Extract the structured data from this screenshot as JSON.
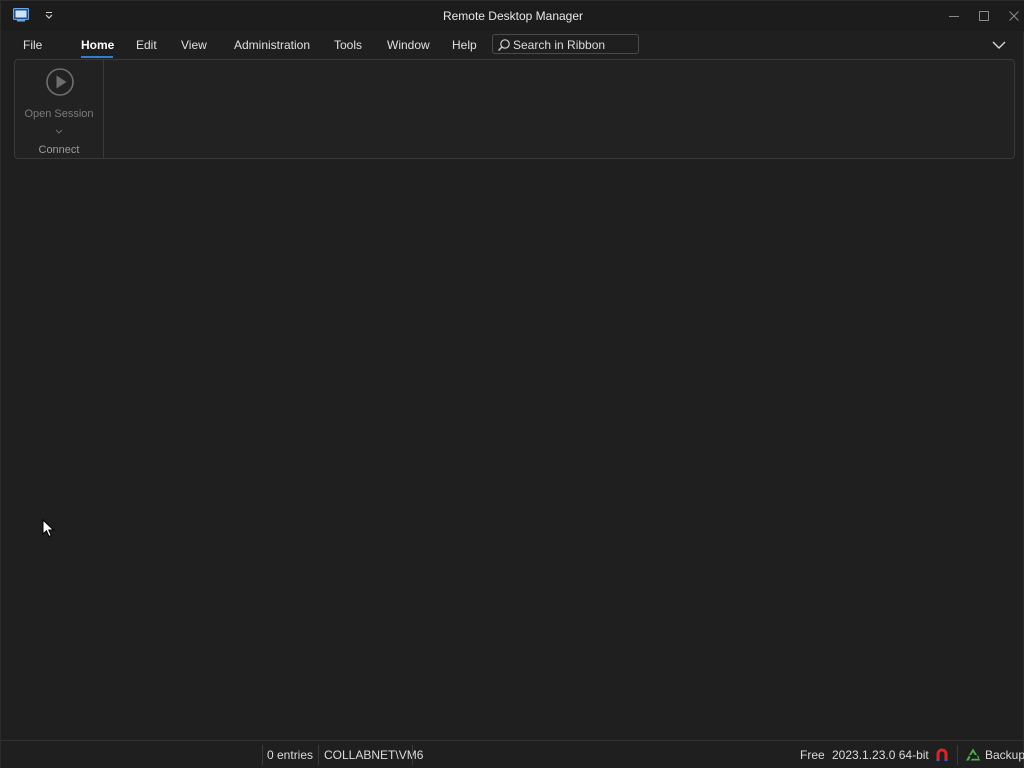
{
  "window": {
    "title": "Remote Desktop Manager"
  },
  "ribbon": {
    "tabs": [
      {
        "label": "File"
      },
      {
        "label": "Home"
      },
      {
        "label": "Edit"
      },
      {
        "label": "View"
      },
      {
        "label": "Administration"
      },
      {
        "label": "Tools"
      },
      {
        "label": "Window"
      },
      {
        "label": "Help"
      }
    ],
    "active_tab": "Home",
    "search_placeholder": "Search in Ribbon",
    "groups": [
      {
        "label": "Connect",
        "buttons": [
          {
            "label": "Open Session",
            "icon": "play-circle-icon",
            "enabled": false
          }
        ]
      }
    ]
  },
  "statusbar": {
    "entries": "0 entries",
    "user": "COLLABNET\\VM6",
    "license": "Free",
    "version": "2023.1.23.0 64-bit",
    "backup_label": "Backup"
  },
  "colors": {
    "background": "#1f1f1f",
    "accent": "#2f7fd8",
    "offline_icon": "#d9262b",
    "backup_icon": "#4caf50"
  }
}
